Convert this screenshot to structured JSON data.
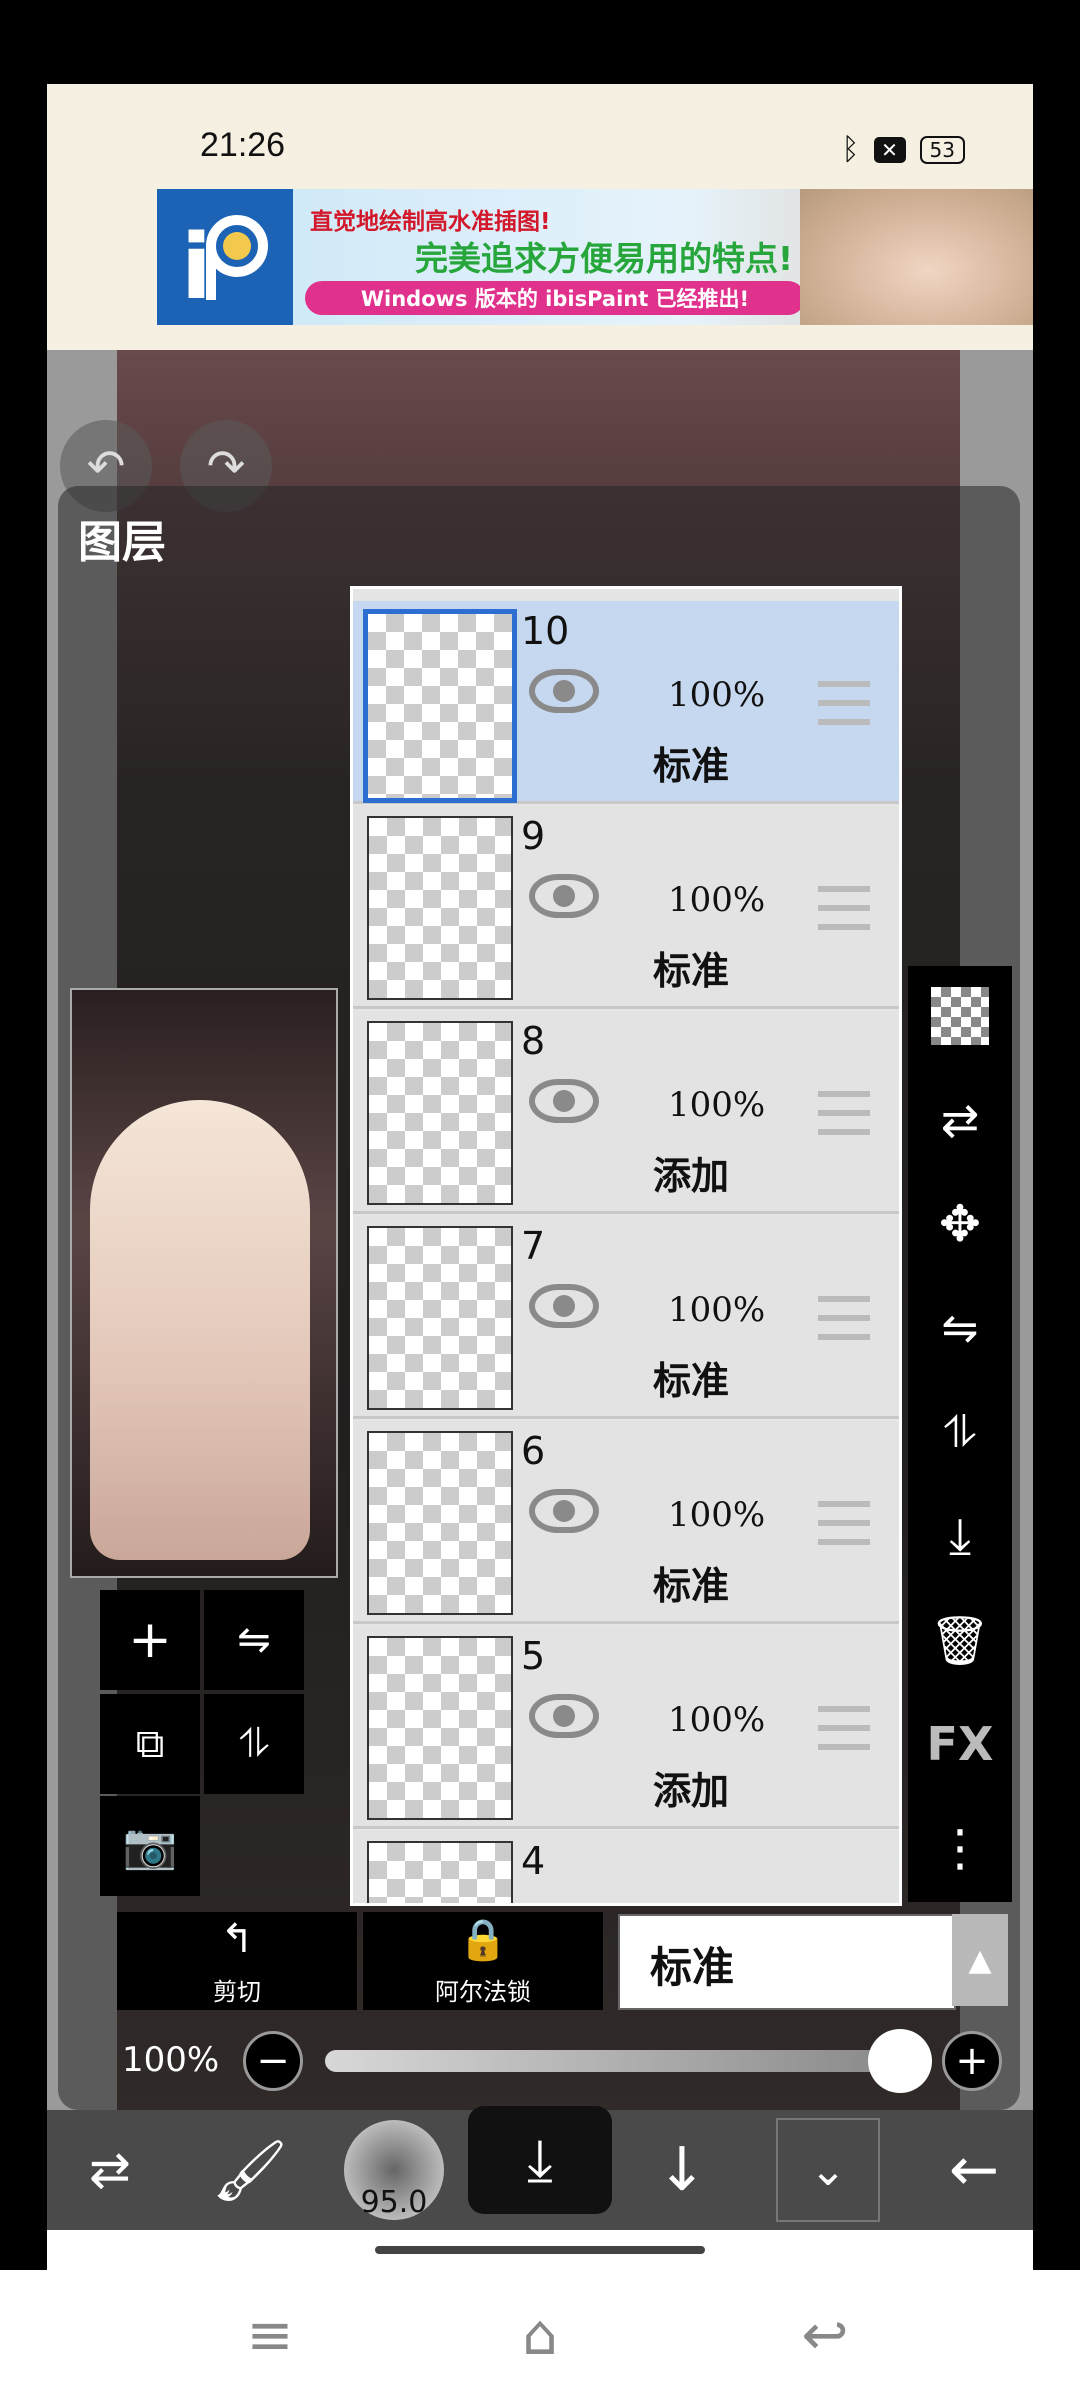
{
  "status_bar": {
    "time": "21:26",
    "bluetooth_icon": "bluetooth-icon",
    "battery": "53"
  },
  "ad": {
    "line1": "直觉地绘制高水准插图!",
    "line2": "完美追求方便易用的特点!",
    "line3": "Windows 版本的 ibisPaint 已经推出!"
  },
  "panel": {
    "title": "图层"
  },
  "layers": [
    {
      "number": "10",
      "opacity": "100%",
      "blend": "标准",
      "selected": true
    },
    {
      "number": "9",
      "opacity": "100%",
      "blend": "标准",
      "selected": false
    },
    {
      "number": "8",
      "opacity": "100%",
      "blend": "添加",
      "selected": false
    },
    {
      "number": "7",
      "opacity": "100%",
      "blend": "标准",
      "selected": false
    },
    {
      "number": "6",
      "opacity": "100%",
      "blend": "标准",
      "selected": false
    },
    {
      "number": "5",
      "opacity": "100%",
      "blend": "添加",
      "selected": false
    },
    {
      "number": "4"
    }
  ],
  "right_toolbar": {
    "fx_label": "FX"
  },
  "controls": {
    "cut_label": "剪切",
    "alpha_lock_label": "阿尔法锁",
    "blend_mode": "标准",
    "opacity": "100%",
    "opacity_value": 1.0
  },
  "bottom_toolbar": {
    "brush_size": "95.0"
  },
  "colors": {
    "selected_layer": "#c5d8ef",
    "selected_border": "#2d6fd0",
    "ad_pink": "#e0328c",
    "ad_green": "#26a63b"
  }
}
